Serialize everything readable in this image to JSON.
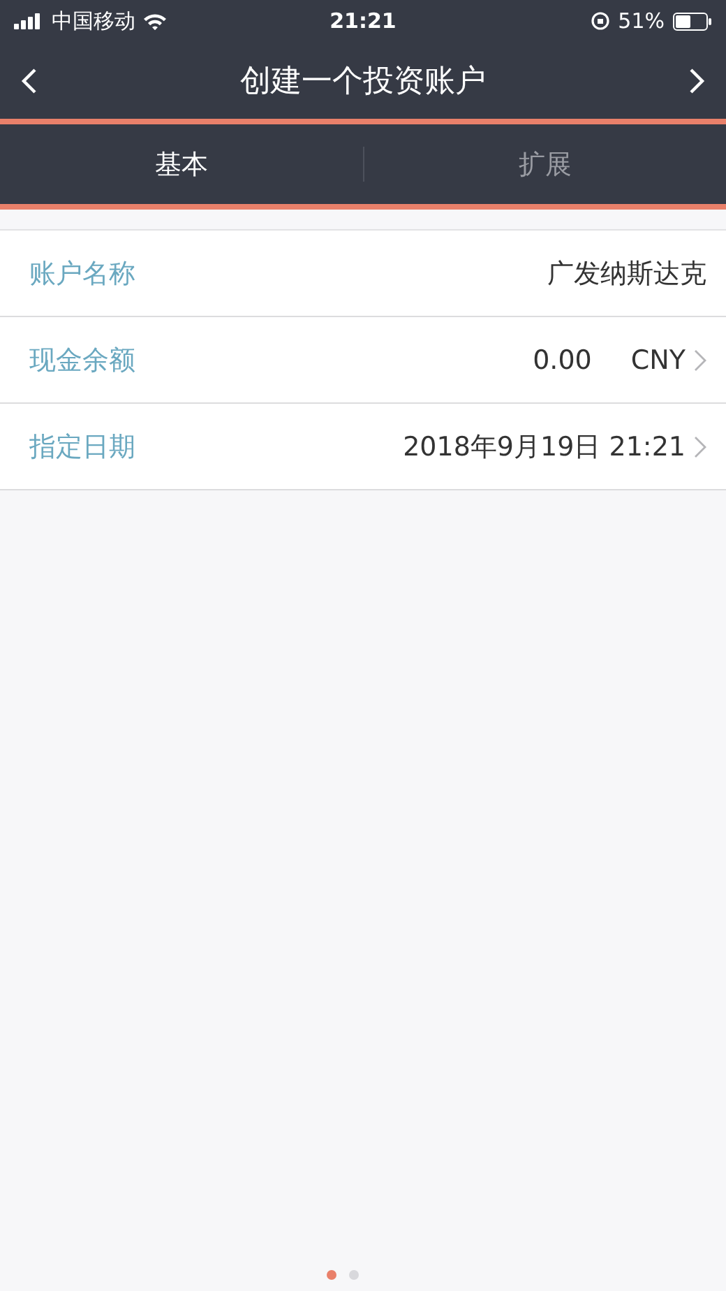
{
  "status_bar": {
    "carrier": "中国移动",
    "time": "21:21",
    "battery": "51%"
  },
  "nav": {
    "title": "创建一个投资账户"
  },
  "tabs": [
    {
      "label": "基本",
      "selected": true
    },
    {
      "label": "扩展",
      "selected": false
    }
  ],
  "rows": [
    {
      "label": "账户名称",
      "value": "广发纳斯达克",
      "has_chevron": false
    },
    {
      "label": "现金余额",
      "value": "0.00",
      "unit": "CNY",
      "has_chevron": true
    },
    {
      "label": "指定日期",
      "value": "2018年9月19日 21:21",
      "has_chevron": true
    }
  ],
  "pages": [
    {
      "selected": true
    },
    {
      "selected": false
    }
  ]
}
